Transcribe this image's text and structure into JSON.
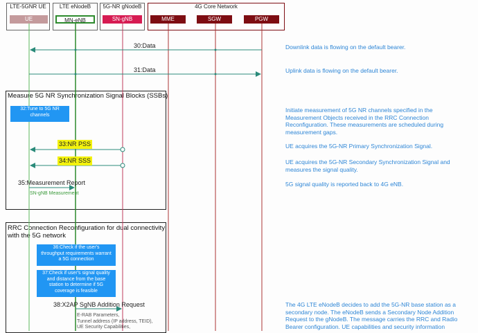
{
  "header": {
    "ue_group": "LTE-5GNR UE",
    "enb_group": "LTE eNodeB",
    "gnb_group": "5G-NR gNodeB",
    "core_group": "4G Core Network",
    "entities": {
      "ue": "UE",
      "mn_enb": "MN-eNB",
      "sn_gnb": "SN-gNB",
      "mme": "MME",
      "sgw": "SGW",
      "pgw": "PGW"
    }
  },
  "messages": {
    "m30": "30:Data",
    "m31": "31:Data",
    "m33": "33:NR PSS",
    "m34": "34:NR SSS",
    "m35": "35:Measurement Report",
    "m35_sub": "SN-gNB Measurement",
    "m38": "38:X2AP SgNB Addition Request",
    "m38_params": [
      "E-RAB Parameters,",
      "Tunnel address (IP address, TEID),",
      "UE Security Capabilities,"
    ]
  },
  "frames": {
    "measure_title": "Measure 5G NR Synchronization Signal Blocks (SSBs)",
    "rrc_title_1": "RRC Connection Reconfiguration for dual connectivity",
    "rrc_title_2": "with the 5G network"
  },
  "actions": {
    "a32": [
      "32:Tune to 5G NR",
      "channels"
    ],
    "a36": [
      "36:Check if the user's",
      "throughput requirements warrant",
      "a 5G connection"
    ],
    "a37": [
      "37:Check if user's signal quality",
      "and distance from the base",
      "station to determine if 5G",
      "coverage is feasible"
    ]
  },
  "notes": {
    "n30": "Downlink data is flowing on the default bearer.",
    "n31": "Uplink data is flowing on the default bearer.",
    "n32": [
      "Initiate measurement of 5G NR channels specified in the",
      "Measurement Objects received in the RRC Connection",
      "Reconfiguration. These measurements are scheduled during",
      "measurement gaps."
    ],
    "n33": "UE acquires the 5G-NR Primary Synchronization Signal.",
    "n34": [
      "UE acquires the 5G-NR Secondary Synchronization Signal and",
      "measures the signal quality."
    ],
    "n35": "5G signal quality is reported back to 4G eNB.",
    "n38": [
      "The 4G LTE eNodeB decides to add the 5G-NR base station as a",
      "secondary node. The eNodeB sends a Secondary Node Addition",
      "Request to the gNodeB. The message carries the RRC and Radio",
      "Bearer configuration. UE capabilities and security information"
    ]
  },
  "colors": {
    "ue": "#c49a9c",
    "mn_enb": "#2c8a2c",
    "sn_gnb": "#d61b52",
    "core": "#7d0d12",
    "note": "#2e86d6",
    "action_box": "#2196f3",
    "highlight": "#f3f20e"
  }
}
